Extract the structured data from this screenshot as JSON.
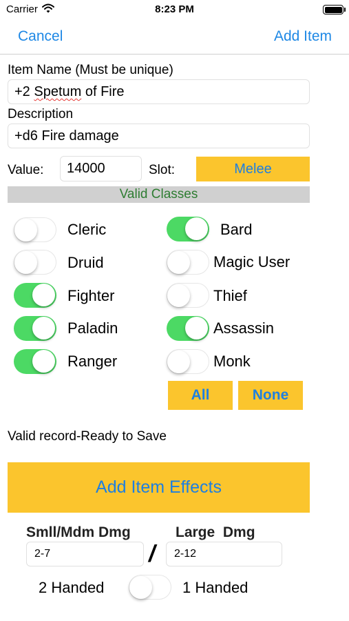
{
  "status_bar": {
    "carrier": "Carrier",
    "time": "8:23 PM"
  },
  "nav": {
    "cancel": "Cancel",
    "add_item": "Add Item"
  },
  "form": {
    "item_name_label": "Item Name (Must be unique)",
    "item_name_prefix": "+2 ",
    "item_name_misspelled": "Spetum",
    "item_name_suffix": " of Fire",
    "description_label": "Description",
    "description_value": "+d6 Fire damage",
    "value_label": "Value:",
    "value_value": "14000",
    "slot_label": "Slot:",
    "slot_value": "Melee"
  },
  "valid_classes": {
    "header": "Valid Classes",
    "left": [
      {
        "label": "Cleric",
        "on": false
      },
      {
        "label": "Druid",
        "on": false
      },
      {
        "label": "Fighter",
        "on": true
      },
      {
        "label": "Paladin",
        "on": true
      },
      {
        "label": "Ranger",
        "on": true
      }
    ],
    "right": [
      {
        "label": "Bard",
        "on": true
      },
      {
        "label": "Magic User",
        "on": false
      },
      {
        "label": "Thief",
        "on": false
      },
      {
        "label": "Assassin",
        "on": true
      },
      {
        "label": "Monk",
        "on": false
      }
    ],
    "all_button": "All",
    "none_button": "None"
  },
  "status_message": "Valid record-Ready to Save",
  "add_effects_button": "Add Item Effects",
  "damage": {
    "small_medium_label": "Smll/Mdm Dmg",
    "large_label": "Large  Dmg",
    "small_medium_value": "2-7",
    "separator": "/",
    "large_value": "2-12"
  },
  "handed": {
    "left_label": "2 Handed",
    "right_label": "1 Handed",
    "toggle_on": false
  },
  "colors": {
    "accent_blue": "#1e88e5",
    "button_yellow": "#fbc52d",
    "toggle_green": "#4cd964",
    "header_gray": "#d0d0d0",
    "header_text_green": "#2e7d32"
  }
}
